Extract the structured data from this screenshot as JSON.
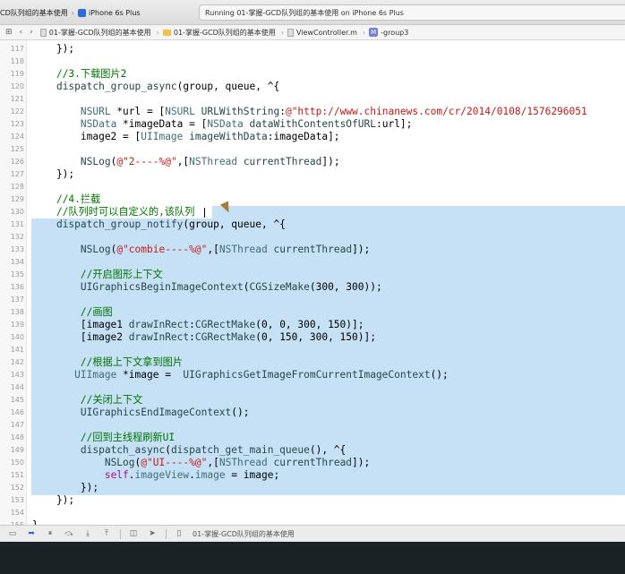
{
  "titlebar": {
    "scheme": "CD队列组的基本使用",
    "device": "iPhone 6s Plus",
    "activity": "Running 01-掌握-GCD队列组的基本使用 on iPhone 6s Plus"
  },
  "jumpbar": {
    "crumbs": [
      "01-掌握-GCD队列组的基本使用",
      "01-掌握-GCD队列组的基本使用",
      "ViewController.m",
      "-group3"
    ]
  },
  "editor": {
    "lines": [
      {
        "num": "117",
        "html": "    });"
      },
      {
        "num": "118",
        "html": ""
      },
      {
        "num": "119",
        "html": "    <span class=\"c\">//3.下载图片2</span>"
      },
      {
        "num": "120",
        "html": "    <span class=\"f\">dispatch_group_async</span>(group, queue, ^{"
      },
      {
        "num": "121",
        "html": ""
      },
      {
        "num": "122",
        "html": "        <span class=\"t\">NSURL</span> *url = [<span class=\"t\">NSURL</span> <span class=\"f\">URLWithString</span>:<span class=\"s\">@\"http://www.chinanews.com/cr/2014/0108/1576296051</span>"
      },
      {
        "num": "123",
        "html": "        <span class=\"t\">NSData</span> *imageData = [<span class=\"t\">NSData</span> <span class=\"f\">dataWithContentsOfURL</span>:url];"
      },
      {
        "num": "124",
        "html": "        image2 = [<span class=\"t\">UIImage</span> <span class=\"f\">imageWithData</span>:imageData];"
      },
      {
        "num": "125",
        "html": ""
      },
      {
        "num": "126",
        "html": "        <span class=\"f\">NSLog</span>(<span class=\"s\">@\"2----%@\"</span>,[<span class=\"t\">NSThread</span> <span class=\"f\">currentThread</span>]);"
      },
      {
        "num": "127",
        "html": "    });"
      },
      {
        "num": "128",
        "html": ""
      },
      {
        "num": "129",
        "html": "    <span class=\"c\">//4.拦截</span>"
      },
      {
        "num": "130",
        "html": "    <span class=\"c\">//队列时可以自定义的,该队列</span>"
      },
      {
        "num": "131",
        "html": "    <span class=\"f\">dispatch_group_notify</span>(group, queue, ^{"
      },
      {
        "num": "132",
        "html": ""
      },
      {
        "num": "133",
        "html": "        <span class=\"f\">NSLog</span>(<span class=\"s\">@\"combie----%@\"</span>,[<span class=\"t\">NSThread</span> <span class=\"f\">currentThread</span>]);"
      },
      {
        "num": "134",
        "html": ""
      },
      {
        "num": "135",
        "html": "        <span class=\"c\">//开启图形上下文</span>"
      },
      {
        "num": "136",
        "html": "        <span class=\"f\">UIGraphicsBeginImageContext</span>(<span class=\"f\">CGSizeMake</span>(300, 300));"
      },
      {
        "num": "137",
        "html": ""
      },
      {
        "num": "138",
        "html": "        <span class=\"c\">//画图</span>"
      },
      {
        "num": "139",
        "html": "        [image1 <span class=\"f\">drawInRect</span>:<span class=\"f\">CGRectMake</span>(0, 0, 300, 150)];"
      },
      {
        "num": "140",
        "html": "        [image2 <span class=\"f\">drawInRect</span>:<span class=\"f\">CGRectMake</span>(0, 150, 300, 150)];"
      },
      {
        "num": "141",
        "html": ""
      },
      {
        "num": "142",
        "html": "        <span class=\"c\">//根据上下文拿到图片</span>"
      },
      {
        "num": "143",
        "html": "       <span class=\"t\">UIImage</span> *image =  <span class=\"f\">UIGraphicsGetImageFromCurrentImageContext</span>();"
      },
      {
        "num": "144",
        "html": ""
      },
      {
        "num": "145",
        "html": "        <span class=\"c\">//关闭上下文</span>"
      },
      {
        "num": "146",
        "html": "        <span class=\"f\">UIGraphicsEndImageContext</span>();"
      },
      {
        "num": "147",
        "html": ""
      },
      {
        "num": "148",
        "html": "        <span class=\"c\">//回到主线程刷新UI</span>"
      },
      {
        "num": "149",
        "html": "        <span class=\"f\">dispatch_async</span>(<span class=\"f\">dispatch_get_main_queue</span>(), ^{"
      },
      {
        "num": "150",
        "html": "            <span class=\"f\">NSLog</span>(<span class=\"s\">@\"UI----%@\"</span>,[<span class=\"t\">NSThread</span> <span class=\"f\">currentThread</span>]);"
      },
      {
        "num": "151",
        "html": "            <span class=\"k\">self</span>.<span class=\"t\">imageView</span>.<span class=\"t\">image</span> = image;"
      },
      {
        "num": "152",
        "html": "        });"
      },
      {
        "num": "153",
        "html": "    });"
      },
      {
        "num": "154",
        "html": ""
      },
      {
        "num": "155",
        "html": "}"
      }
    ]
  },
  "debugbar": {
    "target": "01-掌握-GCD队列组的基本使用"
  }
}
